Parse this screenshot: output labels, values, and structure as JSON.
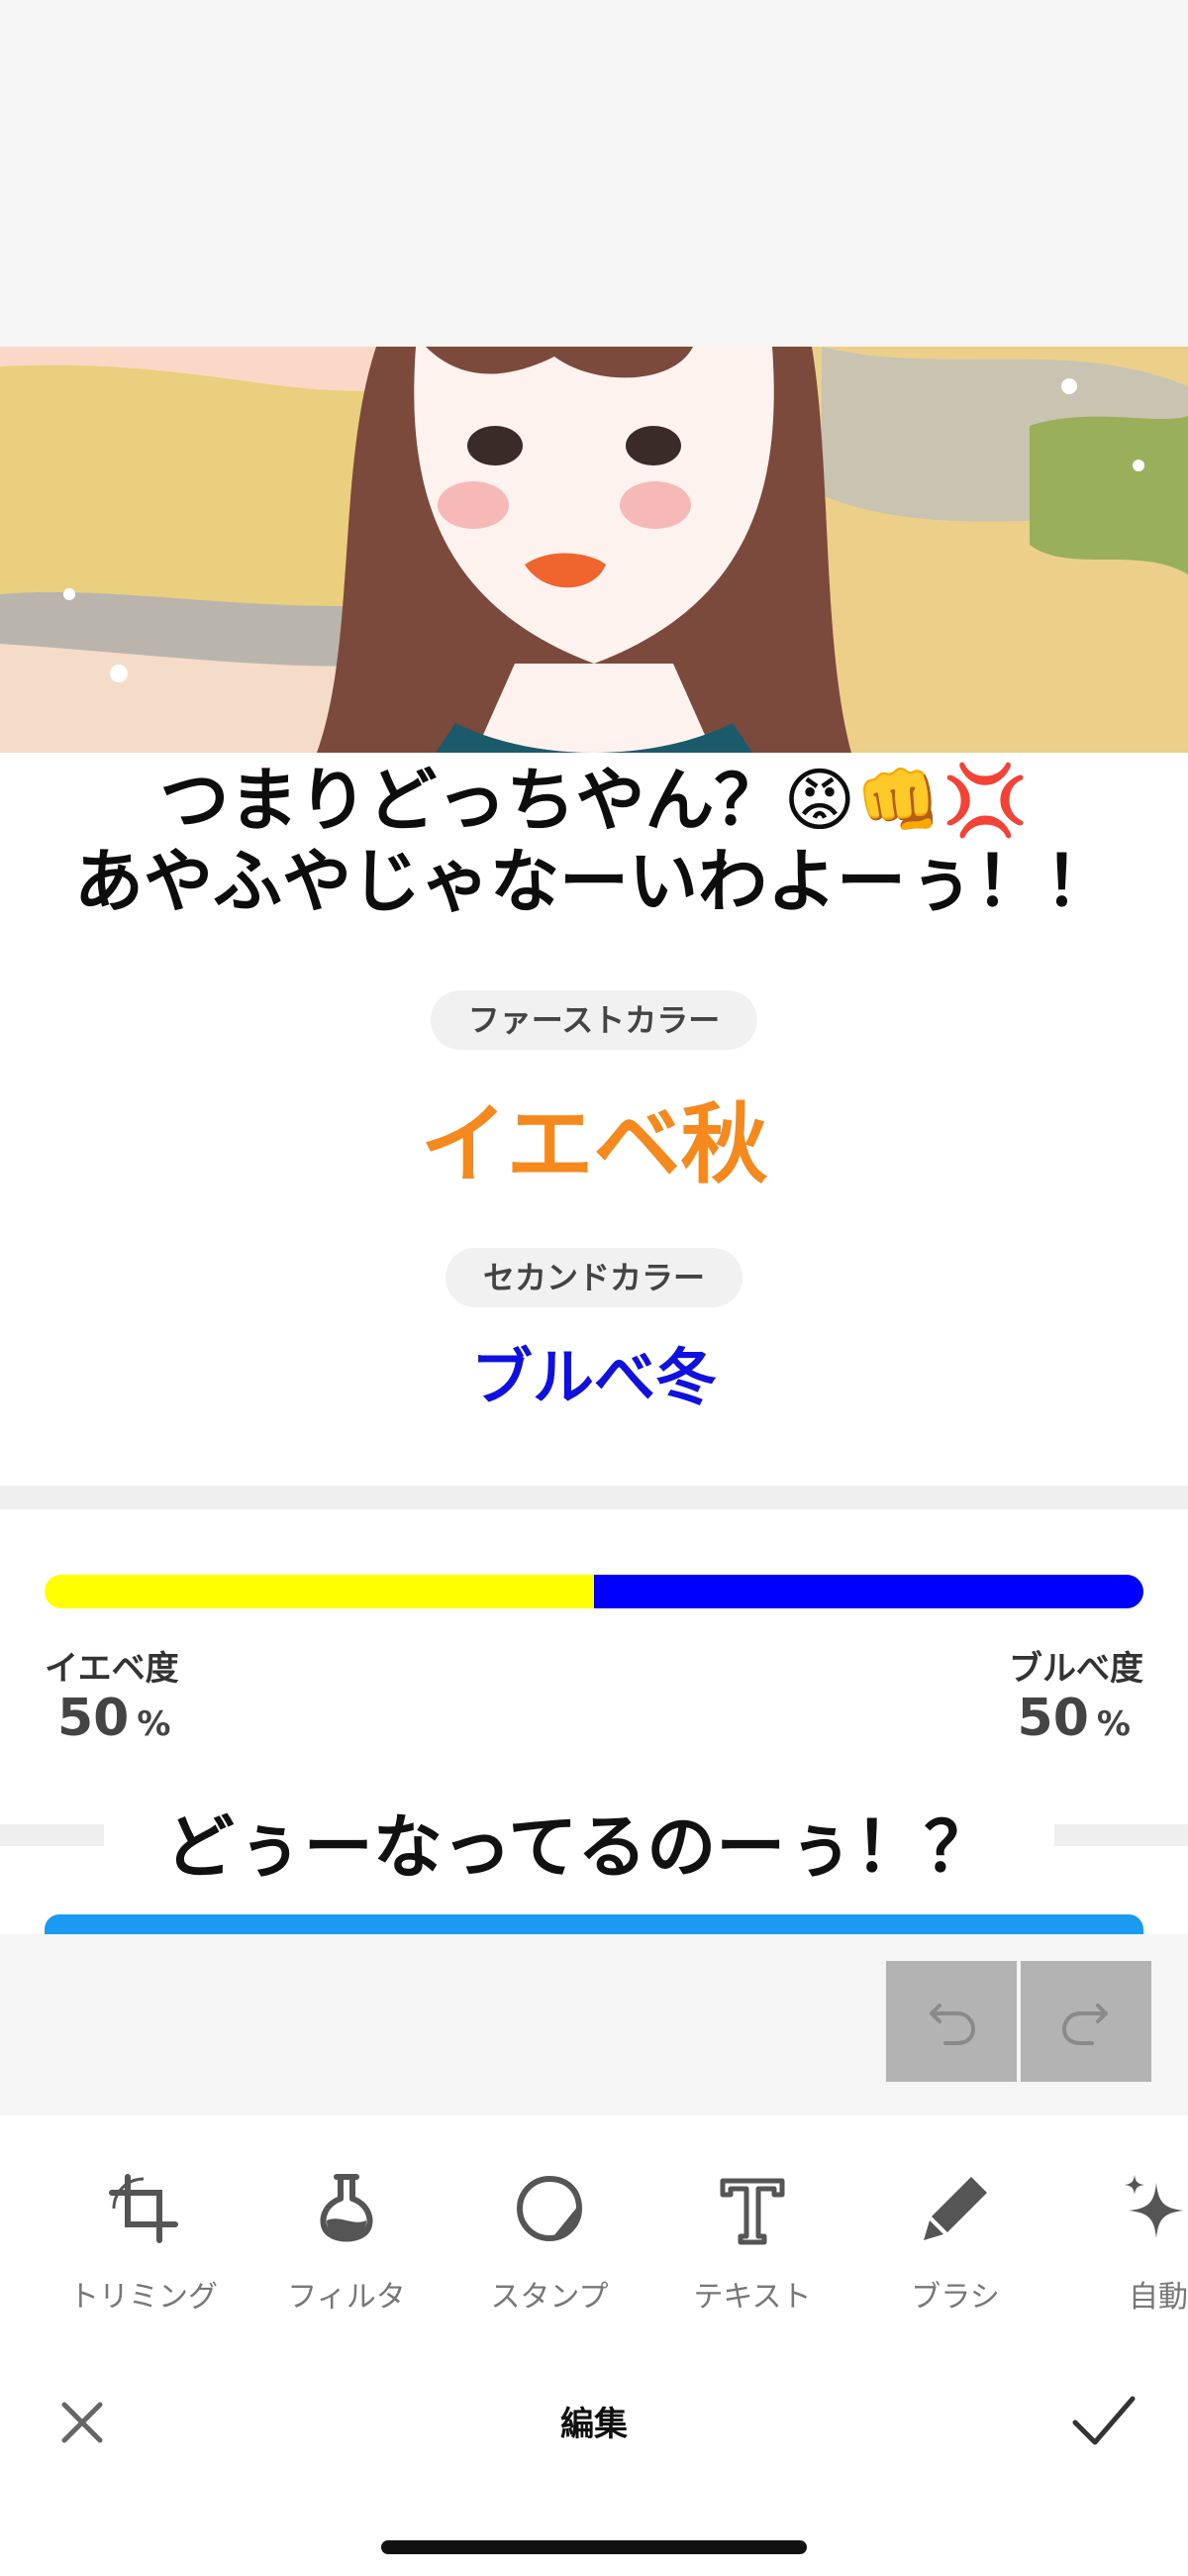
{
  "canvas": {
    "headline_line1": "つまりどっちやん？😡👊💢",
    "headline_line2": "あやふやじゃなーいわよーぅ！！",
    "first_color_label": "ファーストカラー",
    "first_color_value": "イエベ秋",
    "second_color_label": "セカンドカラー",
    "second_color_value": "ブルべ冬",
    "yellow_label": "イエベ度",
    "yellow_percent": "50",
    "blue_label": "ブルべ度",
    "blue_percent": "50",
    "percent_unit": "%",
    "yellow_share": 0.5,
    "question": "どぅーなってるのーぅ！？"
  },
  "colors": {
    "accent_orange": "#f5891e",
    "accent_blue": "#1010e0",
    "bar_yellow": "#ffff00",
    "bar_blue": "#0000ff",
    "line_blue": "#1a9af0"
  },
  "toolbar": {
    "tools": [
      {
        "label": "トリミング",
        "icon": "crop-icon"
      },
      {
        "label": "フィルタ",
        "icon": "filter-flask-icon"
      },
      {
        "label": "スタンプ",
        "icon": "sticker-icon"
      },
      {
        "label": "テキスト",
        "icon": "text-icon"
      },
      {
        "label": "ブラシ",
        "icon": "brush-icon"
      },
      {
        "label": "自動",
        "icon": "sparkle-icon"
      }
    ],
    "title": "編集"
  }
}
